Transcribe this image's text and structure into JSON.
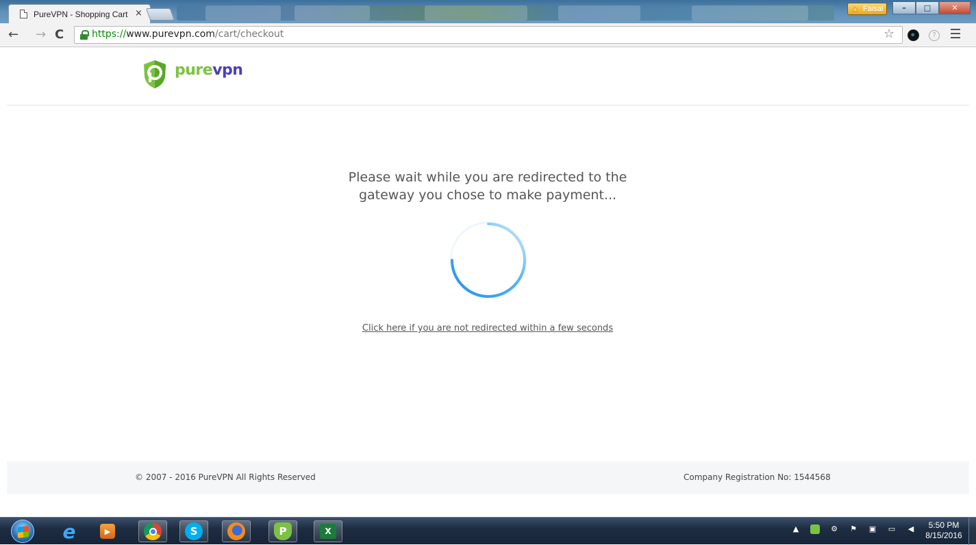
{
  "browser": {
    "tab_title": "PureVPN - Shopping Cart",
    "tab_close": "×",
    "profile_name": "Faisal",
    "url_scheme": "https://",
    "url_host": "www.purevpn.com",
    "url_path": "/cart/checkout"
  },
  "site": {
    "logo_pure": "pure",
    "logo_vpn": "vpn",
    "brand_green": "#7cc242",
    "brand_purple": "#4a3fb8"
  },
  "main": {
    "message_line1": "Please wait while you are redirected to the",
    "message_line2": "gateway you chose to make payment...",
    "redirect_link": "Click here if you are not redirected within a few seconds",
    "spinner_color": "#3aa0f0"
  },
  "footer": {
    "copyright": "© 2007 - 2016 PureVPN All Rights Reserved",
    "registration": "Company Registration No: 1544568"
  },
  "taskbar": {
    "pinned_apps": [
      "internet-explorer-icon",
      "media-player-icon",
      "chrome-icon",
      "skype-icon",
      "firefox-icon",
      "purevpn-icon",
      "excel-icon"
    ],
    "clock_time": "5:50 PM",
    "clock_date": "8/15/2016"
  }
}
